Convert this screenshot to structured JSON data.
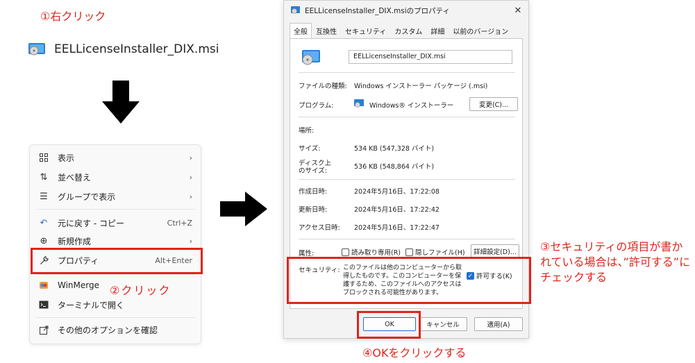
{
  "annotations": {
    "step1": "①右クリック",
    "step2": "②クリック",
    "step3": "③セキュリティの項目が書かれている場合は、”許可する”にチェックする",
    "step4": "④OKをクリックする"
  },
  "file": {
    "name": "EELLicenseInstaller_DIX.msi",
    "icon": "msi-file-icon"
  },
  "context_menu": {
    "items": [
      {
        "icon": "grid-view-icon",
        "label": "表示",
        "right": "›"
      },
      {
        "icon": "sort-icon",
        "label": "並べ替え",
        "right": "›"
      },
      {
        "icon": "group-icon",
        "label": "グループで表示",
        "right": "›"
      },
      {
        "icon": "undo-icon",
        "label": "元に戻す - コピー",
        "right": "Ctrl+Z"
      },
      {
        "icon": "plus-circle-icon",
        "label": "新規作成",
        "right": "›"
      },
      {
        "icon": "wrench-icon",
        "label": "プロパティ",
        "right": "Alt+Enter"
      },
      {
        "icon": "winmerge-icon",
        "label": "WinMerge",
        "right": ""
      },
      {
        "icon": "terminal-icon",
        "label": "ターミナルで開く",
        "right": ""
      },
      {
        "icon": "more-options-icon",
        "label": "その他のオプションを確認",
        "right": ""
      }
    ]
  },
  "dialog": {
    "title": "EELLicenseInstaller_DIX.msiのプロパティ",
    "close": "✕",
    "tabs": [
      "全般",
      "互換性",
      "セキュリティ",
      "カスタム",
      "詳細",
      "以前のバージョン"
    ],
    "filename": "EELLicenseInstaller_DIX.msi",
    "rows": {
      "type_label": "ファイルの種類:",
      "type_value": "Windows インストーラー パッケージ (.msi)",
      "program_label": "プログラム:",
      "program_value": "Windows® インストーラー",
      "change_button": "変更(C)...",
      "location_label": "場所:",
      "size_label": "サイズ:",
      "size_value": "534 KB (547,328 バイト)",
      "disk_size_label_1": "ディスク上",
      "disk_size_label_2": "のサイズ:",
      "disk_size_value": "536 KB (548,864 バイト)",
      "created_label": "作成日時:",
      "created_value": "2024年5月16日、17:22:08",
      "modified_label": "更新日時:",
      "modified_value": "2024年5月16日、17:22:42",
      "accessed_label": "アクセス日時:",
      "accessed_value": "2024年5月16日、17:22:47",
      "attributes_label": "属性:",
      "readonly_label": "読み取り専用(R)",
      "hidden_label": "隠しファイル(H)",
      "advanced_button": "詳細設定(D)...",
      "security_label": "セキュリティ:",
      "security_text": "このファイルは他のコンピューターから取得したものです。このコンピューターを保護するため、このファイルへのアクセスはブロックされる可能性があります。",
      "unblock_label": "許可する(K)"
    },
    "buttons": {
      "ok": "OK",
      "cancel": "キャンセル",
      "apply": "適用(A)"
    }
  },
  "colors": {
    "annotation_red": "#e0241b",
    "checkbox_blue": "#1f6fd1"
  }
}
